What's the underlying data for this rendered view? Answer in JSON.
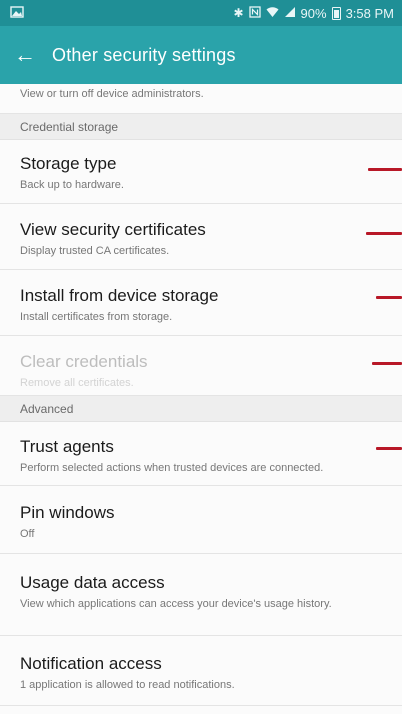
{
  "status_bar": {
    "left_icon": "notification-image-icon",
    "icons": [
      "bluetooth-icon",
      "nfc-icon",
      "wifi-icon",
      "signal-icon"
    ],
    "battery": "90%",
    "time": "3:58 PM"
  },
  "app_bar": {
    "back_icon": "back-arrow-icon",
    "title": "Other security settings"
  },
  "partial_row": {
    "subtitle": "View or turn off device administrators."
  },
  "sections": {
    "credential_storage": "Credential storage",
    "advanced": "Advanced"
  },
  "items": {
    "storage_type": {
      "title": "Storage type",
      "subtitle": "Back up to hardware."
    },
    "view_certs": {
      "title": "View security certificates",
      "subtitle": "Display trusted CA certificates."
    },
    "install": {
      "title": "Install from device storage",
      "subtitle": "Install certificates from storage."
    },
    "clear": {
      "title": "Clear credentials",
      "subtitle": "Remove all certificates."
    },
    "trust": {
      "title": "Trust agents",
      "subtitle": "Perform selected actions when trusted devices are connected."
    },
    "pin": {
      "title": "Pin windows",
      "subtitle": "Off"
    },
    "usage": {
      "title": "Usage data access",
      "subtitle": "View which applications can access your device's usage history."
    },
    "notification": {
      "title": "Notification access",
      "subtitle": "1 application is allowed to read notifications."
    }
  },
  "colors": {
    "status_bar": "#1f8f96",
    "app_bar": "#2aa3aa",
    "annotation_marker": "#b81827"
  }
}
